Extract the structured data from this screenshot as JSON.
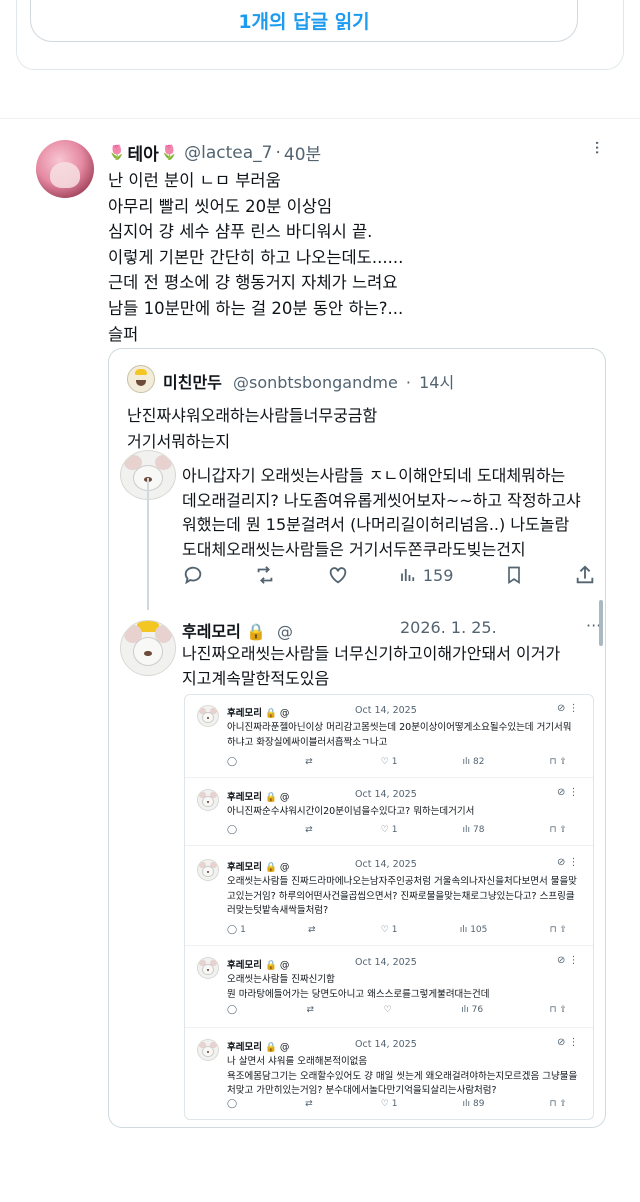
{
  "top": {
    "read_replies": "1개의 답글 읽기"
  },
  "post": {
    "name": "테아",
    "tulip_left": "🌷",
    "tulip_right": "🌷",
    "handle": "@lactea_7",
    "sep": "·",
    "time": "40분",
    "more": "···",
    "lines": [
      "난 이런 분이 ㄴㅁ 부러움",
      "아무리 빨리 씻어도 20분 이상임",
      "심지어 걍 세수 샴푸 린스 바디워시 끝.",
      "이렇게 기본만 간단히 하고 나오는데도......",
      "근데 전 평소에 걍 행동거지 자체가 느려요",
      "남들 10분만에 하는 걸 20분 동안 하는?...",
      "슬퍼"
    ]
  },
  "quote": {
    "name": "미친만두",
    "handle": "@sonbtsbongandme",
    "sep": "·",
    "time": "14시",
    "lines": [
      "난진짜샤워오래하는사람들너무궁금함",
      "거기서뭐하는지"
    ]
  },
  "reply1": {
    "lines": [
      "아니갑자기 오래씻는사람들 ㅈㄴ이해안되네 도대체뭐하는",
      "데오래걸리지? 나도좀여유롭게씻어보자~~하고 작정하고샤",
      "워했는데 뭔 15분걸려서 (나머리길이허리넘음..) 나도놀람",
      "도대체오래씻는사람들은 거기서두쫀쿠라도빚는건지"
    ],
    "views": "159"
  },
  "reply2": {
    "name": "후레모리",
    "at": "@",
    "date": "2026. 1. 25.",
    "more": "···",
    "lines": [
      "나진짜오래씻는사람들 너무신기하고이해가안돼서 이거가",
      "지고계속말한적도있음"
    ]
  },
  "embedded": [
    {
      "name": "후레모리",
      "at": "@",
      "date": "Oct 14, 2025",
      "lines": [
        "아니진짜라푼젤아닌이상 머리감고몸씻는데 20분이상이어떻게소요될수있는데 거기서뭐",
        "하냐고 화장실에싸이블러서흡짝소ㄱ나고"
      ],
      "replies": "",
      "reposts": "",
      "likes": "1",
      "views": "82"
    },
    {
      "name": "후레모리",
      "at": "@",
      "date": "Oct 14, 2025",
      "lines": [
        "아니진짜순수샤워시간이20분이넘을수있다고? 뭐하는데거기서"
      ],
      "replies": "",
      "reposts": "",
      "likes": "1",
      "views": "78"
    },
    {
      "name": "후레모리",
      "at": "@",
      "date": "Oct 14, 2025",
      "lines": [
        "오래씻는사람들 진짜드라마에나오는남자주인공처럼 거울속의나자신을처다보면서 물을맞",
        "고있는거임? 하루의어떤사건을곱씹으면서? 진짜로물을맞는채로그냥있는다고? 스프링클",
        "러맞는텃밭속새싹들처럼?"
      ],
      "replies": "1",
      "reposts": "",
      "likes": "1",
      "views": "105"
    },
    {
      "name": "후레모리",
      "at": "@",
      "date": "Oct 14, 2025",
      "lines": [
        "오래씻는사람들 진짜신기함",
        "뭔 마라탕에들어가는 당면도아니고 왜스스로를그렇게불려대는건데"
      ],
      "replies": "",
      "reposts": "",
      "likes": "",
      "views": "76"
    },
    {
      "name": "후레모리",
      "at": "@",
      "date": "Oct 14, 2025",
      "lines": [
        "나 살면서 샤워를 오래해본적이없음",
        "욕조에몸담그기는 오래할수있어도 걍 매일 씻는게 왜오래걸려야하는지모르겠음 그냥물을",
        "처맞고 가만히있는거임? 분수대에서놀다만기억을되살리는사람처럼?"
      ],
      "replies": "",
      "reposts": "",
      "likes": "1",
      "views": "89"
    }
  ]
}
